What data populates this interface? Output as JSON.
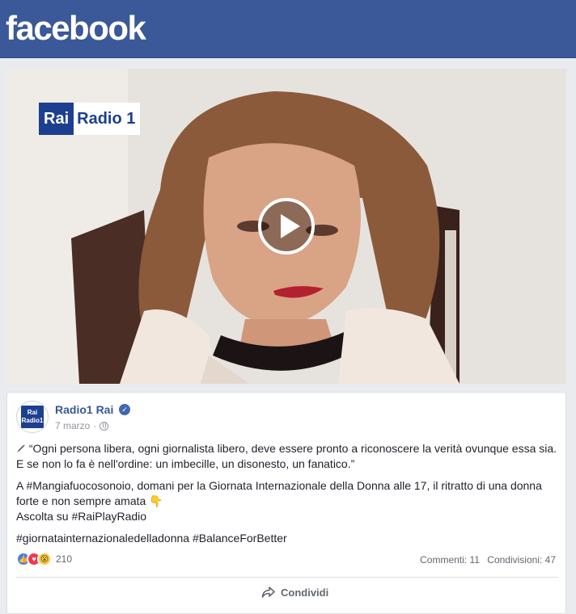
{
  "header": {
    "logo_text": "facebook"
  },
  "video": {
    "overlay_logo_rai": "Rai",
    "overlay_logo_radio": "Radio 1",
    "play_label": "Play"
  },
  "post": {
    "page_name": "Radio1 Rai",
    "avatar_line1": "Rai",
    "avatar_line2": "Radio1",
    "date": "7 marzo",
    "separator": "·",
    "paragraph1": "“Ogni persona libera, ogni giornalista libero, deve essere pronto a riconoscere la verità ovunque essa sia. E se non lo fa è nell'ordine: un imbecille, un disonesto, un fanatico.”",
    "paragraph2_line1": "A #Mangiafuocosonoio, domani per la Giornata Internazionale della Donna alle 17, il ritratto di una donna forte e non sempre amata 👇",
    "paragraph2_line2": "Ascolta su #RaiPlayRadio",
    "paragraph3": "#giornatainternazionaledelladonna #BalanceForBetter",
    "reaction_count": "210",
    "comments": "Commenti: 11",
    "shares": "Condivisioni: 47",
    "share_button": "Condividi"
  },
  "colors": {
    "brand_blue": "#3b5998",
    "link_blue": "#365899",
    "rai_blue": "#1d3f8f"
  }
}
